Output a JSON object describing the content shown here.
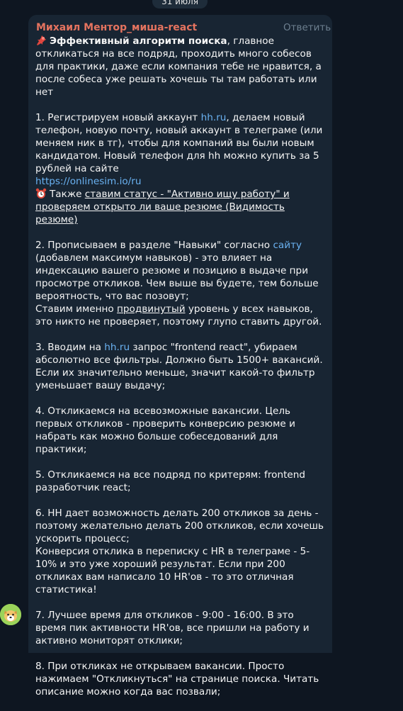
{
  "date_pill": "31 июля",
  "message": {
    "author": "Михаил Ментор_миша-react",
    "reply_label": "Ответить",
    "intro_bold": "Эффективный алгоритм поиска",
    "intro_rest": ", главное откликаться на все подряд, проходить много собесов для практики, даже если компания тебе не нравится, а после собеса уже решать хочешь ты там работать или нет",
    "s1_a": "1. Регистрируем новый аккаунт ",
    "s1_link": "hh.ru",
    "s1_b": ", делаем новый телефон, новую почту, новый аккаунт в телеграме (или меняем ник в тг), чтобы для компаний вы были новым кандидатом. Новый телефон для hh можно купить за 5 рублей на сайте ",
    "s1_url": "https://onlinesim.io/ru",
    "s1_c": "Также ",
    "s1_ul": "ставим статус - \"Активно ищу работу\" и проверяем открыто ли ваше резюме (Видимость резюме)",
    "s2_a": "2. Прописываем в разделе \"Навыки\" согласно ",
    "s2_link": "сайту",
    "s2_b": " (добавлем максимум навыков) - это влияет на индексацию вашего резюме и позицию в выдаче при просмотре откликов. Чем выше вы будете, тем больше вероятность, что вас позовут;",
    "s2_c": "Ставим именно ",
    "s2_ul": "продвинутый",
    "s2_d": " уровень у всех навыков, это никто не проверяет, поэтому глупо ставить другой.",
    "s3_a": "3. Вводим на ",
    "s3_link": "hh.ru",
    "s3_b": " запрос \"frontend react\", убираем абсолютно все фильтры. Должно быть 1500+ вакансий. Если их значительно меньше, значит какой-то фильтр уменьшает вашу выдачу;",
    "s4": "4. Откликаемся на всевозможные вакансии. Цель первых откликов - проверить конверсию резюме и набрать как можно больше собеседований для практики;",
    "s5": "5. Откликаемся на все подряд по критерям: frontend разработчик react;",
    "s6_a": "6. HH дает возможность делать 200 откликов за день - поэтому желательно делать 200 откликов, если хочешь ускорить процесс;",
    "s6_b": "Конверсия отклика в переписку с HR в телеграме - 5-10% и это уже хороший результат. Если при 200 откликах вам написало 10 HR'ов - то это отличная статистика!",
    "s7": "7. Лучшее время для откликов - 9:00 - 16:00. В это время пик активности HR'ов, все пришли на работу и активно мониторят отклики;",
    "s8": "8. При откликах не открываем вакансии. Просто нажимаем \"Откликнуться\" на странице поиска. Читать описание можно когда вас позвали;"
  },
  "icons": {
    "pin": "pushpin-icon",
    "alarm": "alarm-clock-icon",
    "avatar": "avatar-icon"
  },
  "colors": {
    "background": "#0e1621",
    "bubble": "#182533",
    "author": "#e4735f",
    "link": "#6ab2f2"
  }
}
